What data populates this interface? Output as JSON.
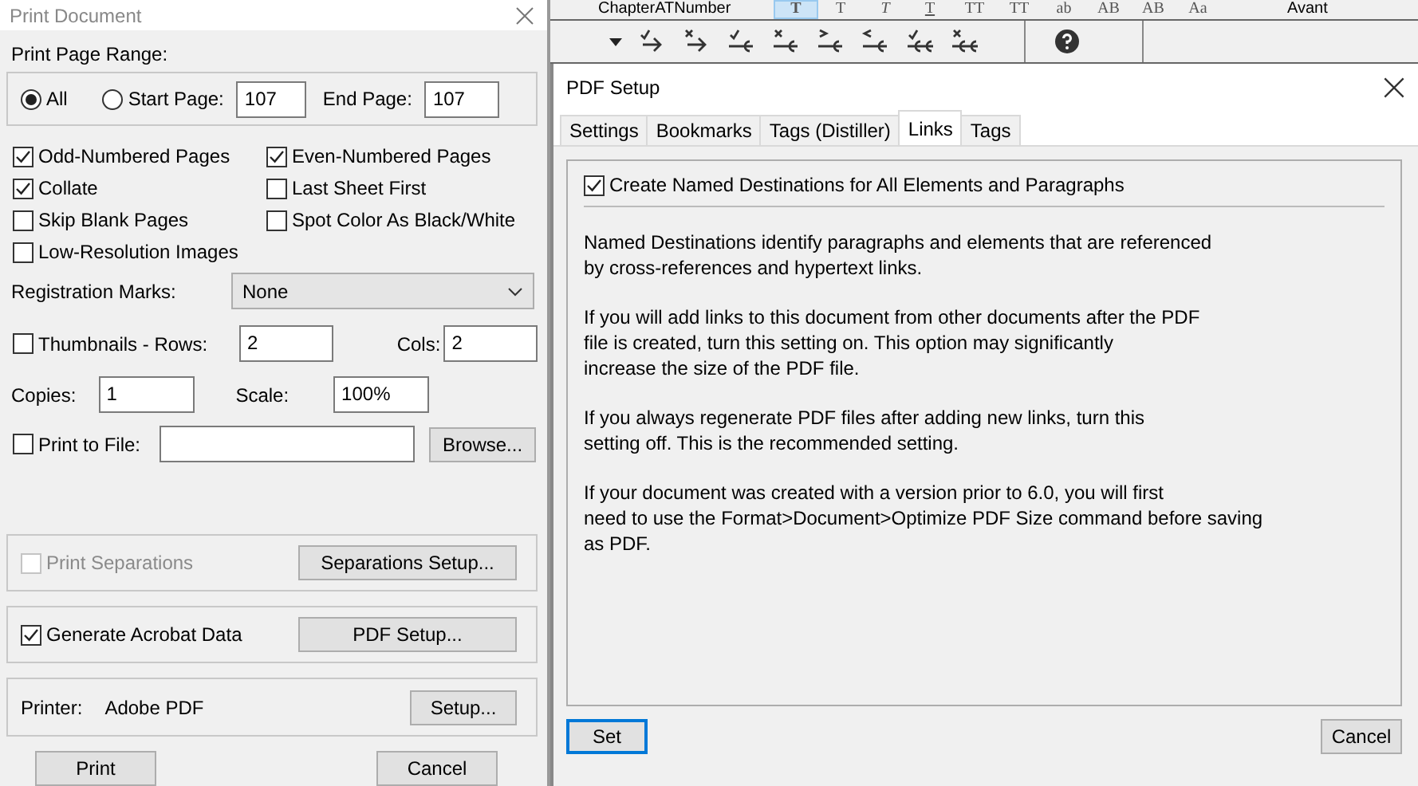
{
  "print_document": {
    "title": "Print Document",
    "page_range": {
      "label": "Print Page Range:",
      "options": [
        {
          "label": "All",
          "selected": true
        },
        {
          "label": "Start Page:",
          "selected": false
        }
      ],
      "start_page": "107",
      "end_page_label": "End Page:",
      "end_page": "107"
    },
    "options": [
      {
        "label": "Odd-Numbered Pages",
        "checked": true
      },
      {
        "label": "Even-Numbered Pages",
        "checked": true
      },
      {
        "label": "Collate",
        "checked": true
      },
      {
        "label": "Last Sheet First",
        "checked": false
      },
      {
        "label": "Skip Blank Pages",
        "checked": false
      },
      {
        "label": "Spot Color As Black/White",
        "checked": false
      },
      {
        "label": "Low-Resolution Images",
        "checked": false
      }
    ],
    "registration_marks": {
      "label": "Registration Marks:",
      "value": "None"
    },
    "thumbnails": {
      "label": "Thumbnails - Rows:",
      "checked": false,
      "rows": "2",
      "cols_label": "Cols:",
      "cols": "2"
    },
    "copies": {
      "label": "Copies:",
      "value": "1"
    },
    "scale": {
      "label": "Scale:",
      "value": "100%"
    },
    "print_to_file": {
      "label": "Print to File:",
      "checked": false,
      "button": "Browse..."
    },
    "groups": [
      {
        "label": "Print Separations",
        "checked": false,
        "disabled": true,
        "button": "Separations Setup..."
      },
      {
        "label": "Generate Acrobat Data",
        "checked": true,
        "disabled": false,
        "button": "PDF Setup..."
      }
    ],
    "printer": {
      "label": "Printer:",
      "name": "Adobe PDF",
      "button": "Setup..."
    },
    "buttons": [
      "Print",
      "Cancel"
    ]
  },
  "toolbar": {
    "paragraph_format": "ChapterATNumber",
    "format_buttons": [
      {
        "label": "T",
        "kind": "bold",
        "selected": true
      },
      {
        "label": "T",
        "kind": "plain",
        "selected": false
      },
      {
        "label": "T",
        "kind": "italic",
        "selected": false
      },
      {
        "label": "T",
        "kind": "underline",
        "selected": false
      },
      {
        "label": "TT",
        "kind": "plain",
        "selected": false
      },
      {
        "label": "TT",
        "kind": "plain",
        "selected": false
      },
      {
        "label": "ab",
        "kind": "plain",
        "selected": false
      },
      {
        "label": "AB",
        "kind": "plain",
        "selected": false
      },
      {
        "label": "AB",
        "kind": "plain",
        "selected": false
      },
      {
        "label": "Aa",
        "kind": "plain",
        "selected": false
      }
    ],
    "font": "Avant"
  },
  "pdf_setup": {
    "title": "PDF Setup",
    "tabs": [
      {
        "label": "Settings",
        "selected": false
      },
      {
        "label": "Bookmarks",
        "selected": false
      },
      {
        "label": "Tags (Distiller)",
        "selected": false
      },
      {
        "label": "Links",
        "selected": true
      },
      {
        "label": "Tags",
        "selected": false
      }
    ],
    "create_named_destinations": {
      "label": "Create Named Destinations for All Elements and Paragraphs",
      "checked": true
    },
    "paragraphs": [
      "Named Destinations identify paragraphs and elements that are referenced\nby cross-references and hypertext links.",
      "If you will add links to this document from other documents after the PDF\nfile is created, turn this setting on.  This option may significantly\nincrease the size of the PDF file.",
      "If you always regenerate PDF files after adding new links, turn this\nsetting off.  This is the recommended setting.",
      "If your document was created with a version prior to 6.0, you will first\nneed to use the Format>Document>Optimize PDF Size command before saving\nas PDF."
    ],
    "buttons": [
      {
        "label": "Set",
        "selected": true
      },
      {
        "label": "Cancel",
        "selected": false
      }
    ]
  }
}
